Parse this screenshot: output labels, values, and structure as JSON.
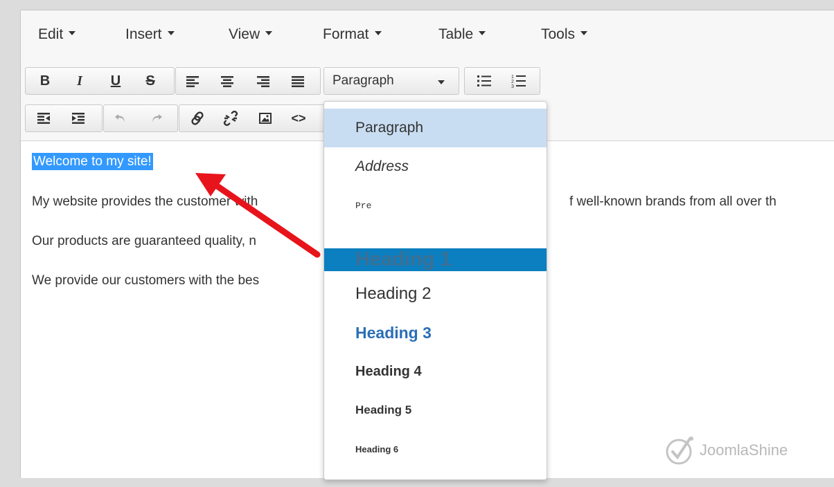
{
  "menubar": {
    "items": [
      {
        "label": "Edit"
      },
      {
        "label": "Insert"
      },
      {
        "label": "View"
      },
      {
        "label": "Format"
      },
      {
        "label": "Table"
      },
      {
        "label": "Tools"
      }
    ]
  },
  "toolbar": {
    "bold": "B",
    "italic": "I",
    "underline": "U",
    "strikethrough": "S",
    "format_select": "Paragraph",
    "code": "<>"
  },
  "content": {
    "selected_heading": "Welcome to my site!",
    "paragraphs": [
      "My website provides the customer with",
      "Our products are guaranteed quality, n",
      "We provide our customers with the bes"
    ],
    "para1_tail": "f well-known brands from all over th"
  },
  "format_dropdown": {
    "items": [
      {
        "label": "Paragraph"
      },
      {
        "label": "Address"
      },
      {
        "label": "Pre"
      },
      {
        "label": "Heading 1"
      },
      {
        "label": "Heading 2"
      },
      {
        "label": "Heading 3"
      },
      {
        "label": "Heading 4"
      },
      {
        "label": "Heading 5"
      },
      {
        "label": "Heading 6"
      }
    ],
    "highlighted": "Paragraph",
    "active": "Heading 1"
  },
  "watermark": {
    "text": "JoomlaShine"
  },
  "colors": {
    "selection": "#3399ff",
    "dropdown_active": "#0b7fc0",
    "dropdown_highlight": "#c9ddf2",
    "heading3_blue": "#2a6fb5",
    "arrow_red": "#e8141b"
  }
}
